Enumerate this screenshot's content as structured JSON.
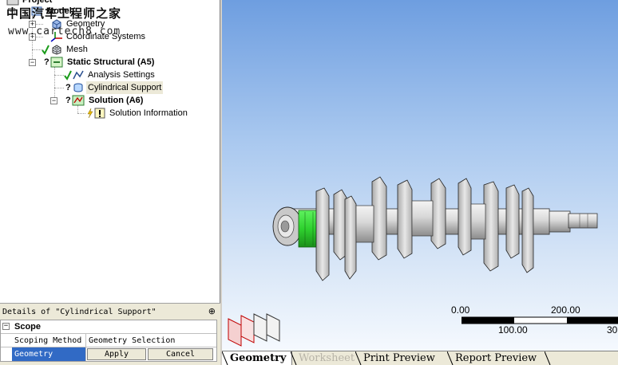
{
  "watermark": {
    "line1": "中国汽车工程师之家",
    "line2": "www.cartech8.com"
  },
  "tree": {
    "project_label": "Project",
    "model_label": "Model",
    "items": [
      {
        "label": "Geometry"
      },
      {
        "label": "Coordinate Systems"
      },
      {
        "label": "Mesh"
      },
      {
        "label": "Static Structural (A5)"
      },
      {
        "label": "Analysis Settings"
      },
      {
        "label": "Cylindrical Support"
      },
      {
        "label": "Solution (A6)"
      },
      {
        "label": "Solution Information"
      }
    ]
  },
  "details": {
    "title": "Details of \"Cylindrical Support\"",
    "pin": "⊕",
    "group_label": "Scope",
    "rows": [
      {
        "key": "Scoping Method",
        "value": "Geometry Selection"
      },
      {
        "key": "Geometry",
        "apply": "Apply",
        "cancel": "Cancel"
      }
    ]
  },
  "scale": {
    "top_left": "0.00",
    "top_right": "200.00",
    "bottom_mid": "100.00",
    "bottom_right": "30"
  },
  "tabs": [
    {
      "label": "Geometry",
      "state": "active"
    },
    {
      "label": "Worksheet",
      "state": "disabled"
    },
    {
      "label": "Print Preview",
      "state": "normal"
    },
    {
      "label": "Report Preview",
      "state": "normal"
    }
  ],
  "colors": {
    "selection_green": "#2fd12f",
    "viewport_top": "#6e9ee0",
    "viewport_bottom": "#f5f9fe",
    "selected_row": "#316ac5"
  },
  "icons": [
    "expand-icon",
    "collapse-icon",
    "geometry-icon",
    "coordinate-systems-icon",
    "mesh-icon",
    "static-structural-icon",
    "analysis-settings-icon",
    "cylindrical-support-icon",
    "solution-icon",
    "solution-information-icon",
    "pin-icon",
    "triad-icon"
  ]
}
